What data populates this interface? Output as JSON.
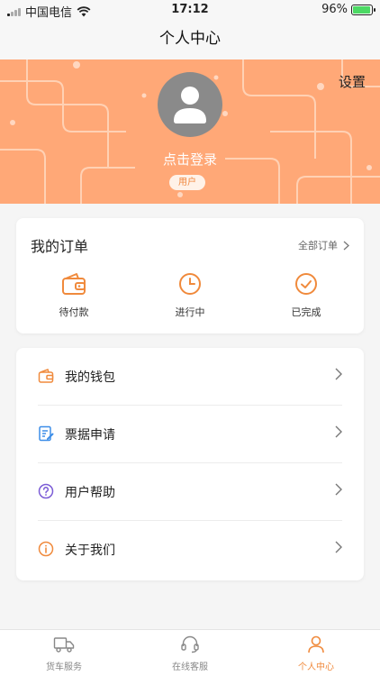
{
  "status_bar": {
    "carrier": "中国电信",
    "time": "17:12",
    "battery": "96%",
    "battery_level": 0.96
  },
  "nav": {
    "title": "个人中心"
  },
  "header": {
    "settings_label": "设置",
    "login_label": "点击登录",
    "role_badge": "用户"
  },
  "orders": {
    "title": "我的订单",
    "all_label": "全部订单",
    "items": [
      {
        "label": "待付款",
        "icon": "wallet-icon"
      },
      {
        "label": "进行中",
        "icon": "clock-icon"
      },
      {
        "label": "已完成",
        "icon": "check-circle-icon"
      }
    ]
  },
  "menu": {
    "items": [
      {
        "label": "我的钱包",
        "icon": "wallet-icon"
      },
      {
        "label": "票据申请",
        "icon": "document-edit-icon"
      },
      {
        "label": "用户帮助",
        "icon": "help-icon"
      },
      {
        "label": "关于我们",
        "icon": "info-icon"
      }
    ]
  },
  "tabbar": {
    "items": [
      {
        "label": "货车服务",
        "icon": "truck-icon",
        "active": false
      },
      {
        "label": "在线客服",
        "icon": "headset-icon",
        "active": false
      },
      {
        "label": "个人中心",
        "icon": "user-icon",
        "active": true
      }
    ]
  },
  "colors": {
    "accent": "#f08a3c",
    "banner": "#ffa877",
    "help_icon": "#7b5cd6",
    "doc_icon": "#3d8ee8"
  }
}
